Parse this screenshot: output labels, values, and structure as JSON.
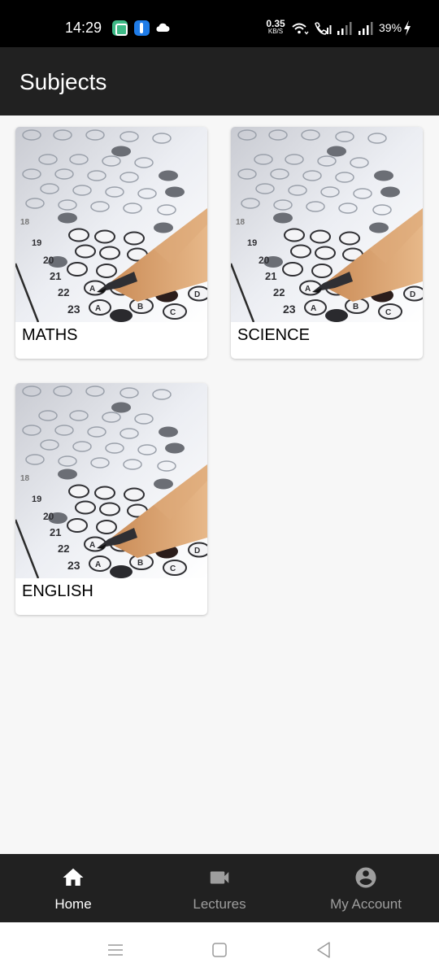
{
  "status_bar": {
    "time": "14:29",
    "net_speed_value": "0.35",
    "net_speed_unit": "KB/S",
    "battery": "39%",
    "icons": [
      "chat-app-icon",
      "app-notification-icon",
      "cloud-icon",
      "wifi-icon",
      "wifi-calling-icon",
      "signal-icon",
      "signal-icon",
      "charging-icon"
    ]
  },
  "app_bar": {
    "title": "Subjects"
  },
  "subjects": [
    {
      "label": "MATHS",
      "image": "exam-answer-sheet-with-pencil"
    },
    {
      "label": "SCIENCE",
      "image": "exam-answer-sheet-with-pencil"
    },
    {
      "label": "ENGLISH",
      "image": "exam-answer-sheet-with-pencil"
    }
  ],
  "bottom_nav": {
    "items": [
      {
        "label": "Home",
        "icon": "home-icon",
        "active": true
      },
      {
        "label": "Lectures",
        "icon": "video-camera-icon",
        "active": false
      },
      {
        "label": "My Account",
        "icon": "account-circle-icon",
        "active": false
      }
    ]
  },
  "colors": {
    "app_bar": "#212121",
    "bottom_nav": "#212121",
    "background": "#f7f7f7",
    "nav_active": "#ffffff",
    "nav_inactive": "#9e9e9e"
  }
}
